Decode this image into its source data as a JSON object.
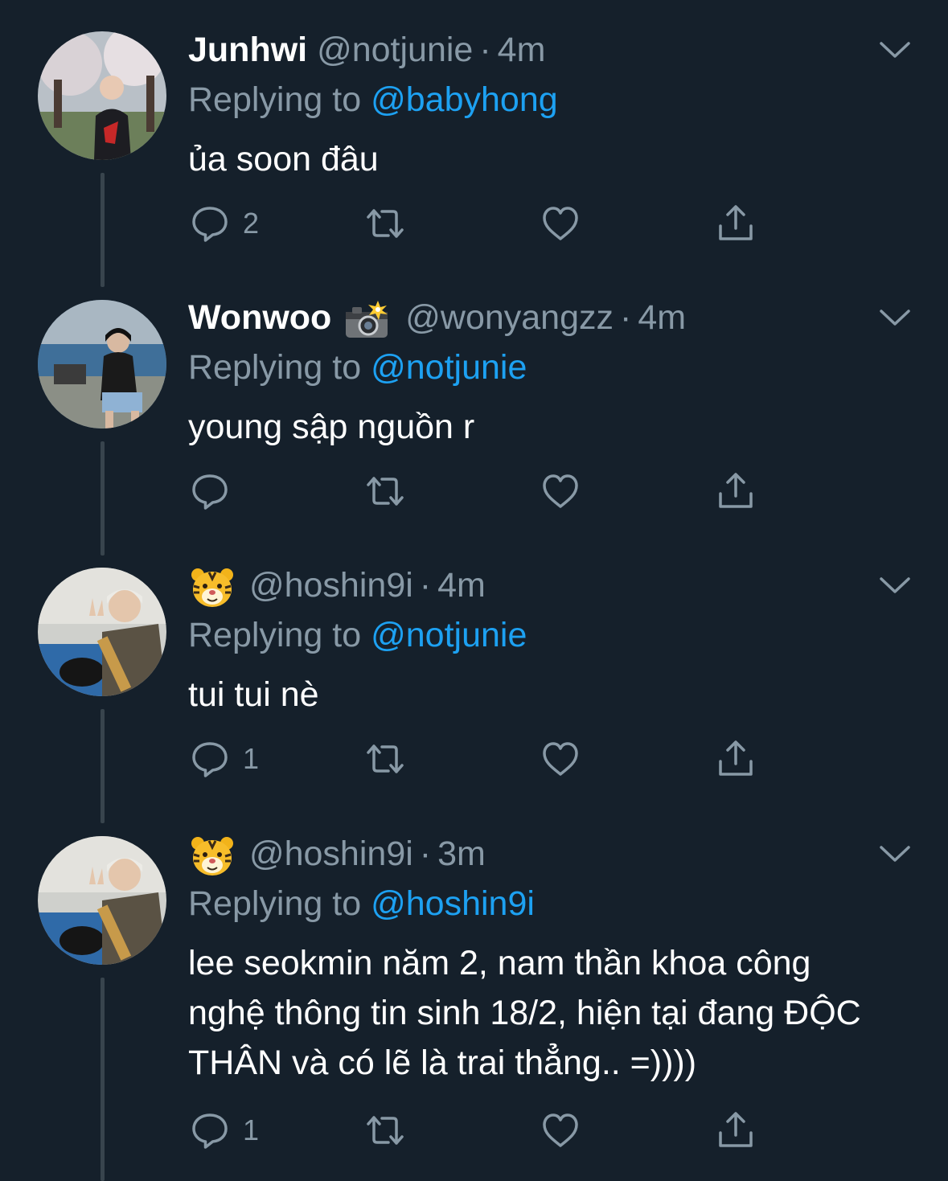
{
  "colors": {
    "background": "#15202b",
    "text_primary": "#ffffff",
    "text_secondary": "#8899a6",
    "link": "#1da1f2",
    "thread_line": "#38444d"
  },
  "tweets": [
    {
      "display_name": "Junhwi",
      "name_emoji": "",
      "handle": "@notjunie",
      "separator": "·",
      "time": "4m",
      "replying_prefix": "Replying to",
      "replying_to": "@babyhong",
      "text": "ủa soon đâu",
      "reply_count": "2",
      "retweet_count": "",
      "like_count": "",
      "avatar_icon": "avatar-photo-junhwi"
    },
    {
      "display_name": "Wonwoo",
      "name_emoji": "camera-flash-emoji",
      "handle": "@wonyangzz",
      "separator": "·",
      "time": "4m",
      "replying_prefix": "Replying to",
      "replying_to": "@notjunie",
      "text": "young sập nguồn r",
      "reply_count": "",
      "retweet_count": "",
      "like_count": "",
      "avatar_icon": "avatar-photo-wonwoo"
    },
    {
      "display_name": "",
      "name_emoji": "tiger-face-emoji",
      "handle": "@hoshin9i",
      "separator": "·",
      "time": "4m",
      "replying_prefix": "Replying to",
      "replying_to": "@notjunie",
      "text": "tui tui nè",
      "reply_count": "1",
      "retweet_count": "",
      "like_count": "",
      "avatar_icon": "avatar-photo-hoshi"
    },
    {
      "display_name": "",
      "name_emoji": "tiger-face-emoji",
      "handle": "@hoshin9i",
      "separator": "·",
      "time": "3m",
      "replying_prefix": "Replying to",
      "replying_to": "@hoshin9i",
      "text": "lee seokmin năm 2, nam thần khoa công nghệ thông tin sinh 18/2, hiện tại đang ĐỘC THÂN và có lẽ là trai thẳng.. =))))",
      "reply_count": "1",
      "retweet_count": "",
      "like_count": "",
      "avatar_icon": "avatar-photo-hoshi"
    }
  ]
}
